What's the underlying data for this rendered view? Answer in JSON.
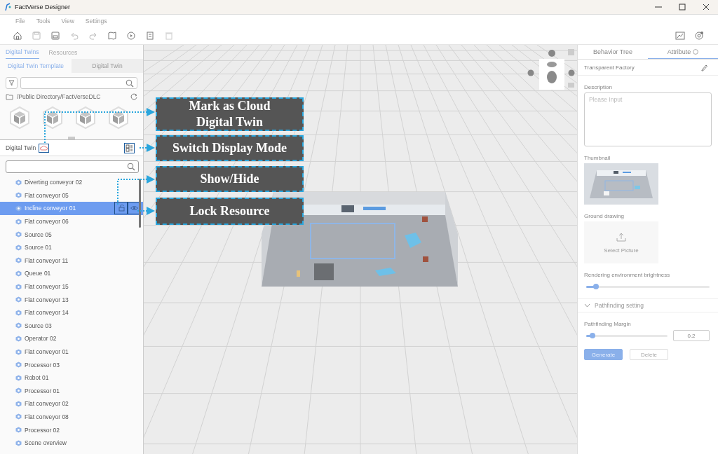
{
  "window": {
    "title": "FactVerse Designer"
  },
  "menu": [
    "File",
    "Tools",
    "View",
    "Settings"
  ],
  "left_panel": {
    "tabs": [
      {
        "label": "Digital Twins",
        "selected": true
      },
      {
        "label": "Resources",
        "selected": false
      }
    ],
    "subtabs": [
      {
        "label": "Digital Twin Template",
        "selected": true
      },
      {
        "label": "Digital Twin",
        "selected": false
      }
    ],
    "path": "/Public Directory/FactVerseDLC",
    "digital_twin": {
      "title": "Digital Twin",
      "items": [
        {
          "label": "Diverting conveyor 02",
          "selected": false
        },
        {
          "label": "Flat conveyor 05",
          "selected": false
        },
        {
          "label": "Incline conveyor 01",
          "selected": true
        },
        {
          "label": "Flat conveyor 06",
          "selected": false
        },
        {
          "label": "Source 05",
          "selected": false
        },
        {
          "label": "Source 01",
          "selected": false
        },
        {
          "label": "Flat conveyor 11",
          "selected": false
        },
        {
          "label": "Queue 01",
          "selected": false
        },
        {
          "label": "Flat conveyor 15",
          "selected": false
        },
        {
          "label": "Flat conveyor 13",
          "selected": false
        },
        {
          "label": "Flat conveyor 14",
          "selected": false
        },
        {
          "label": "Source 03",
          "selected": false
        },
        {
          "label": "Operator 02",
          "selected": false
        },
        {
          "label": "Flat conveyor 01",
          "selected": false
        },
        {
          "label": "Processor 03",
          "selected": false
        },
        {
          "label": "Robot 01",
          "selected": false
        },
        {
          "label": "Processor 01",
          "selected": false
        },
        {
          "label": "Flat conveyor 02",
          "selected": false
        },
        {
          "label": "Flat conveyor 08",
          "selected": false
        },
        {
          "label": "Processor 02",
          "selected": false
        },
        {
          "label": "Scene overview",
          "selected": false
        }
      ]
    }
  },
  "annotations": [
    "Mark as Cloud Digital Twin",
    "Switch Display Mode",
    "Show/Hide",
    "Lock Resource"
  ],
  "right_panel": {
    "tabs": [
      {
        "label": "Behavior Tree",
        "selected": false
      },
      {
        "label": "Attribute",
        "selected": true
      }
    ],
    "name": "Transparent Factory",
    "description": {
      "label": "Description",
      "placeholder": "Please Input"
    },
    "thumbnail_label": "Thumbnail",
    "ground_drawing": {
      "label": "Ground drawing",
      "button": "Select Picture"
    },
    "brightness": {
      "label": "Rendering environment brightness",
      "level": 0.08
    },
    "pathfinding": {
      "title": "Pathfinding setting",
      "expanded": true,
      "margin_label": "Pathfinding Margin",
      "level": 0.08,
      "value": "0.2"
    },
    "buttons": [
      {
        "label": "Generate",
        "disabled": false
      },
      {
        "label": "Delete",
        "disabled": true
      }
    ]
  }
}
